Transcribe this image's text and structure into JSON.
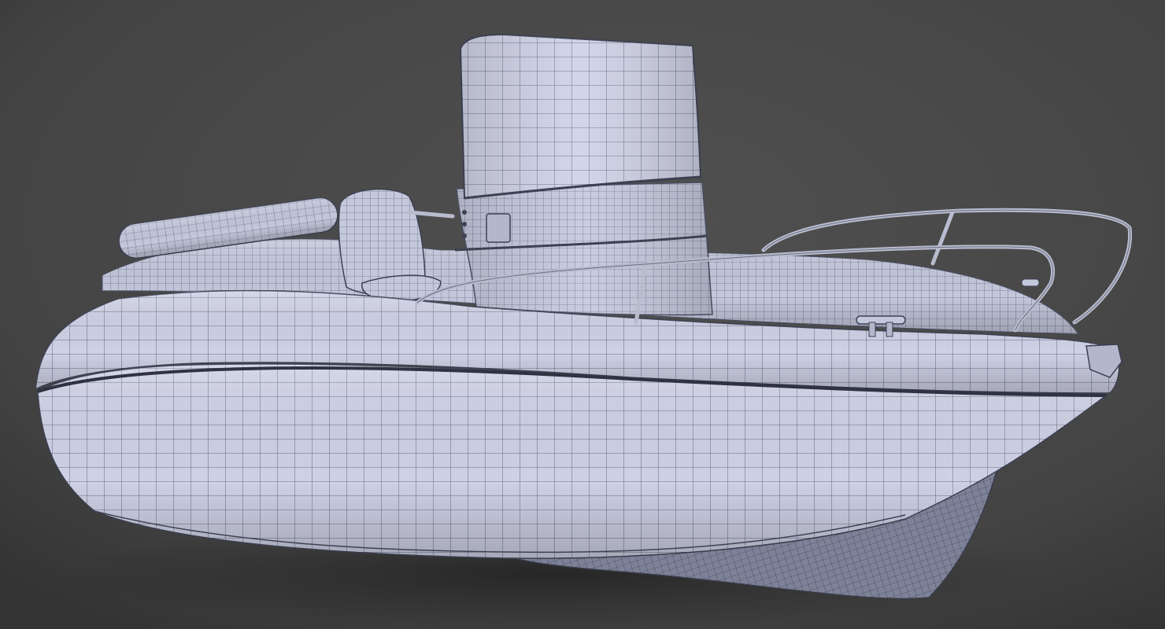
{
  "scene": {
    "subject": "boat-wireframe-render",
    "colors": {
      "background": "#4a4a4a",
      "background_dark": "#2c2c2c",
      "surface": "#c9cce0",
      "surface_shadow": "#8a8ea6",
      "wire": "#3d4152",
      "rail": "#b9bccd"
    }
  }
}
